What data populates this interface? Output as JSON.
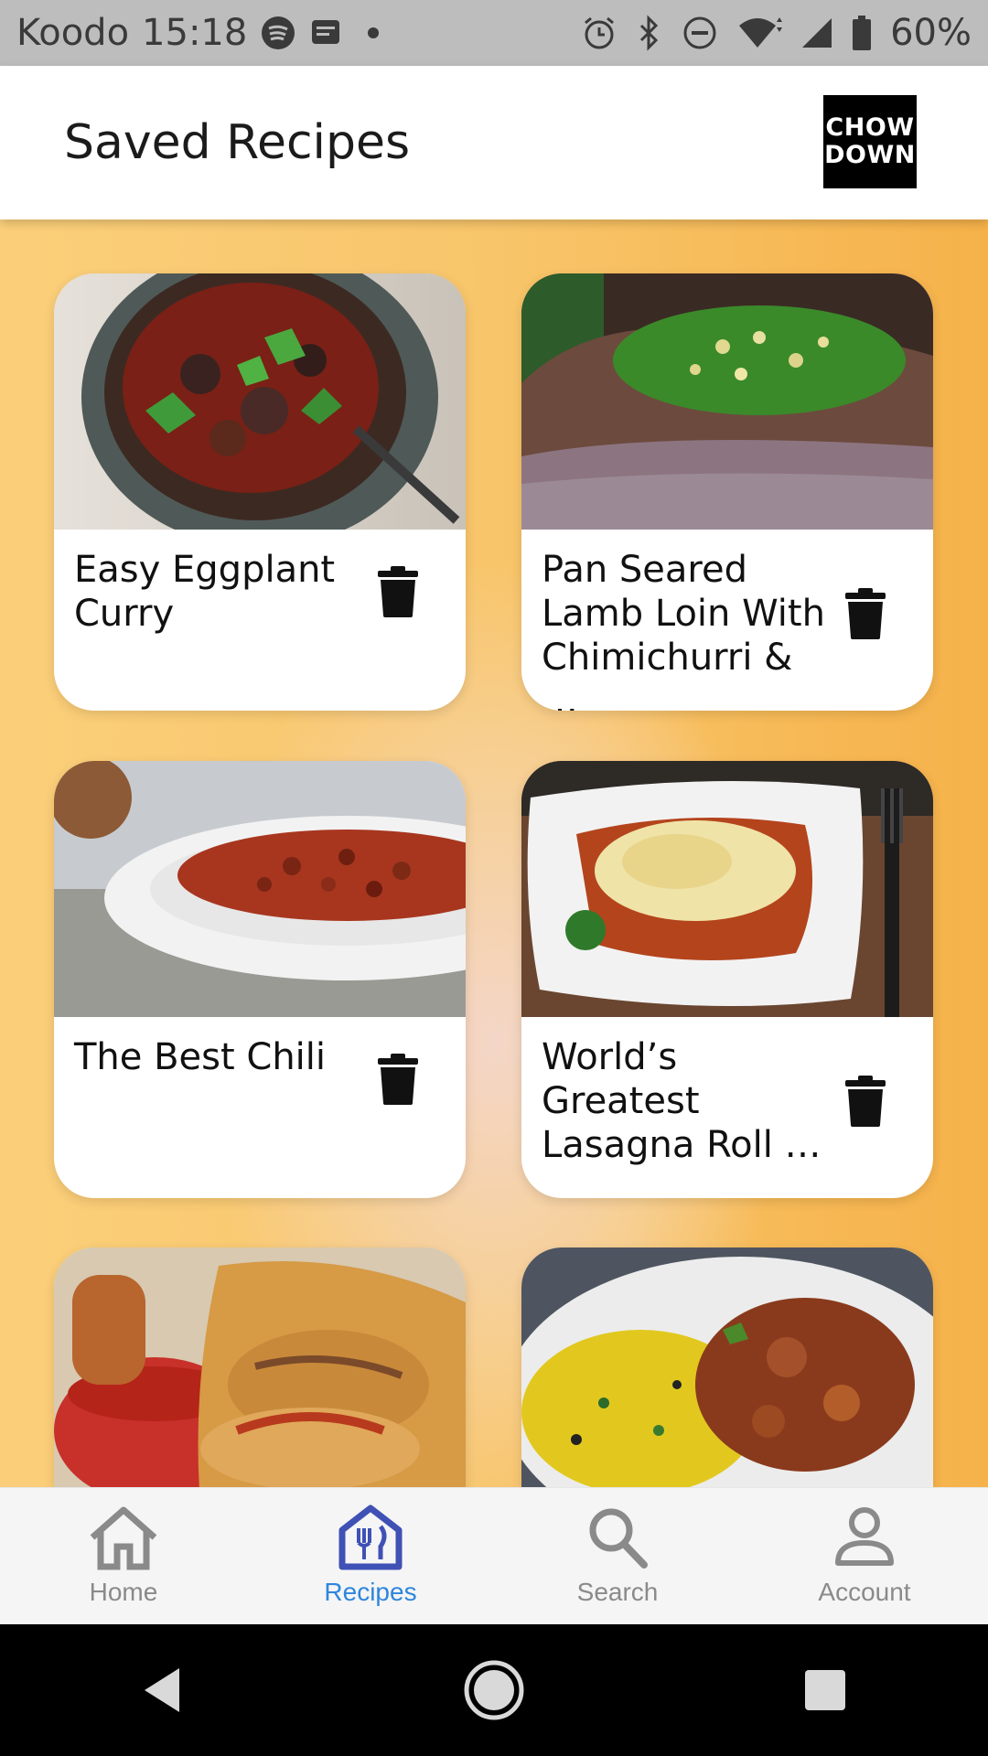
{
  "status_bar": {
    "carrier": "Koodo",
    "time": "15:18",
    "battery": "60%"
  },
  "app_bar": {
    "title": "Saved Recipes",
    "logo_line1": "CHOW",
    "logo_line2": "DOWN"
  },
  "recipes": [
    {
      "title": "Easy Eggplant Curry",
      "icon": "trash-icon"
    },
    {
      "title": "Pan Seared Lamb Loin With Chimichurri & …",
      "icon": "trash-icon"
    },
    {
      "title": "The Best Chili",
      "icon": "trash-icon"
    },
    {
      "title": "World’s Greatest Lasagna Roll …",
      "icon": "trash-icon"
    },
    {
      "title": "",
      "icon": ""
    },
    {
      "title": "",
      "icon": ""
    }
  ],
  "bottom_nav": {
    "items": [
      {
        "label": "Home",
        "icon": "home-icon",
        "active": false
      },
      {
        "label": "Recipes",
        "icon": "recipes-icon",
        "active": true
      },
      {
        "label": "Search",
        "icon": "search-icon",
        "active": false
      },
      {
        "label": "Account",
        "icon": "account-icon",
        "active": false
      }
    ],
    "active_color": "#2e86de",
    "inactive_color": "#8a8a8a"
  },
  "colors": {
    "background_orange": "#f6b84e",
    "card": "#ffffff",
    "status_bar": "#bdbdbd"
  }
}
